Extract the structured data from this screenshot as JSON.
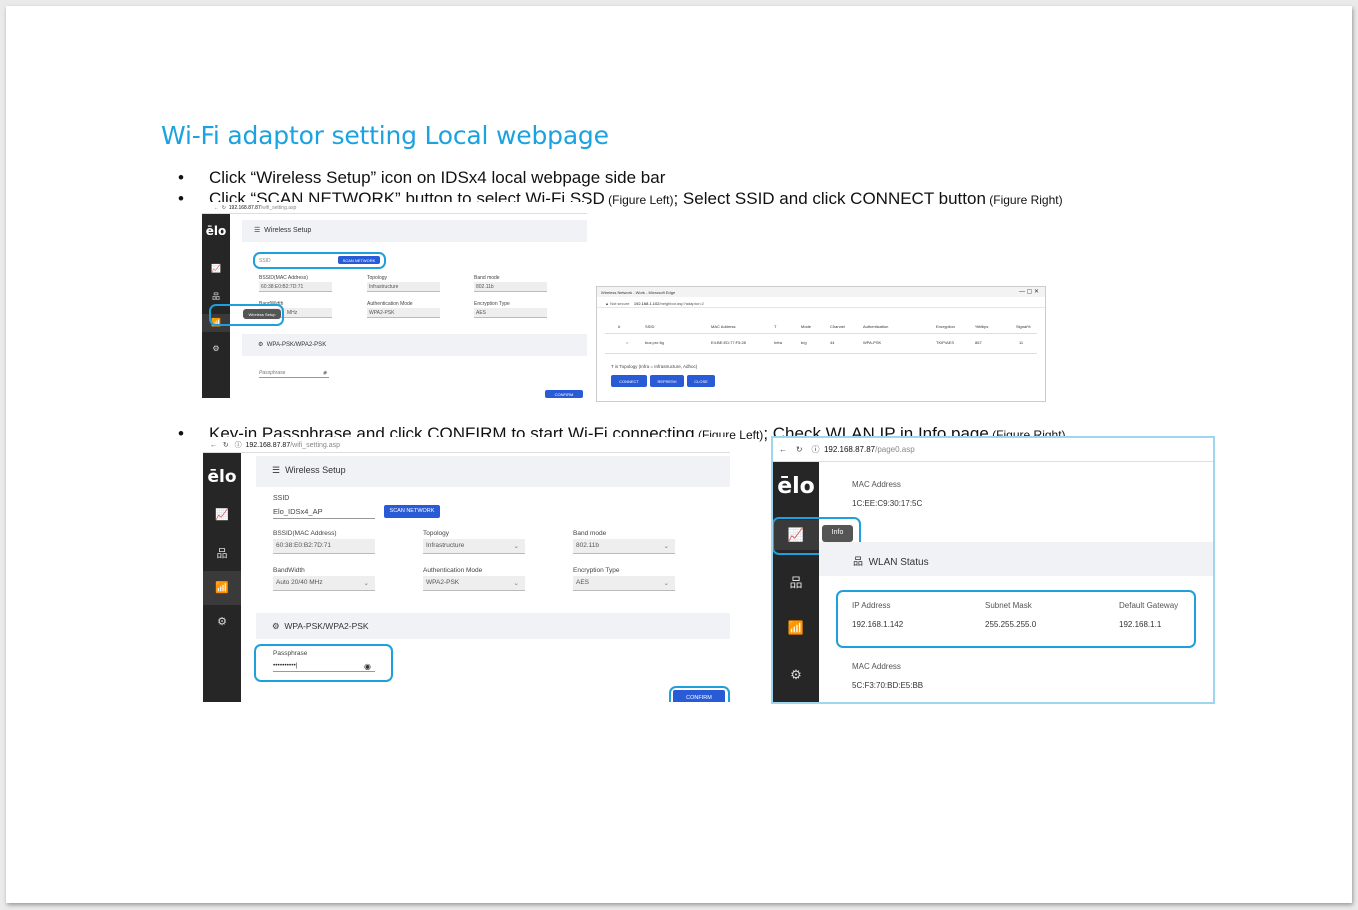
{
  "slide": {
    "title": "Wi-Fi adaptor setting Local webpage",
    "bullet1": "Click “Wireless Setup” icon on IDSx4 local webpage side bar",
    "bullet2_main": "Click “SCAN NETWORK” button to select Wi-Fi SSD",
    "bullet2_note1": " (Figure Left)",
    "bullet2_sep": "; Select SSID and click CONNECT button",
    "bullet2_note2": " (Figure Right)",
    "bullet3_main": "Key-in Passphrase and click CONFIRM to start Wi-Fi connecting",
    "bullet3_note1": " (Figure Left)",
    "bullet3_sep": "; Check WLAN IP in Info page",
    "bullet3_note2": " (Figure Right)",
    "bullet_dot": "•"
  },
  "shot1": {
    "url_host": "192.168.87.87",
    "url_path": "/wifi_setting.asp",
    "logo": "ēlo",
    "header": "Wireless Setup",
    "ssid_placeholder": "SSID",
    "scan_button": "SCAN NETWORK",
    "bssid_label": "BSSID(MAC Address)",
    "bssid_value": "60:38:E0:B2:7D:71",
    "topology_label": "Topology",
    "topology_value": "Infrastructure",
    "band_label": "Band mode",
    "band_value": "802.11b",
    "bandwidth_label": "BandWidth",
    "bandwidth_value": "MHz",
    "auth_label": "Authentication Mode",
    "auth_value": "WPA2-PSK",
    "enc_label": "Encryption Type",
    "enc_value": "AES",
    "tooltip": "Wireless Setup",
    "section": "WPA-PSK/WPA2-PSK",
    "passphrase_placeholder": "Passphrase",
    "confirm_button": "CONFIRM"
  },
  "shot2": {
    "window_title": "Wireless Network - Work - Microsoft Edge",
    "win_controls": "—   ▢   ✕",
    "not_secure": "Not secure",
    "url_host": "192.168.1.102",
    "url_path": "/neighbor.asp?adaptor=2",
    "columns": [
      "#",
      "SSID",
      "MAC Address",
      "T",
      "Mode",
      "Channel",
      "Authentication",
      "Encryption",
      "%Mbps",
      "Signal%"
    ],
    "row": [
      "○",
      "bus pro 6g",
      "E4:BE:ED:77:F5:28",
      "Infra",
      "b/g",
      "44",
      "WPA-PSK",
      "TKIP/AES",
      "867",
      "11"
    ],
    "legend": "T is Topology (Infra = Infrastructure, Adhoc)",
    "connect_button": "CONNECT",
    "refresh_button": "REFRESH",
    "close_button": "CLOSE"
  },
  "shot3": {
    "url_host": "192.168.87.87",
    "url_path": "/wifi_setting.asp",
    "logo": "ēlo",
    "header": "Wireless Setup",
    "ssid_label": "SSID",
    "ssid_value": "Elo_IDSx4_AP",
    "scan_button": "SCAN NETWORK",
    "bssid_label": "BSSID(MAC Address)",
    "bssid_value": "60:38:E0:B2:7D:71",
    "topology_label": "Topology",
    "topology_value": "Infrastructure",
    "band_label": "Band mode",
    "band_value": "802.11b",
    "bandwidth_label": "BandWidth",
    "bandwidth_value": "Auto 20/40 MHz",
    "auth_label": "Authentication Mode",
    "auth_value": "WPA2-PSK",
    "enc_label": "Encryption Type",
    "enc_value": "AES",
    "section": "WPA-PSK/WPA2-PSK",
    "passphrase_label": "Passphrase",
    "passphrase_value": "••••••••••|",
    "confirm_button": "CONFIRM"
  },
  "shot4": {
    "url_host": "192.168.87.87",
    "url_path": "/page0.asp",
    "logo": "ēlo",
    "mac_label": "MAC Address",
    "mac_value": "1C:EE:C9:30:17:5C",
    "tooltip": "Info",
    "section": "WLAN Status",
    "ip_label": "IP Address",
    "ip_value": "192.168.1.142",
    "mask_label": "Subnet Mask",
    "mask_value": "255.255.255.0",
    "gw_label": "Default Gateway",
    "gw_value": "192.168.1.1",
    "mac2_label": "MAC Address",
    "mac2_value": "5C:F3:70:BD:E5:BB"
  },
  "icons": {
    "chart": "📈",
    "network": "品",
    "wifi": "📶",
    "gears": "⚙",
    "menu": "☰",
    "eye": "◉",
    "back": "←",
    "reload": "↻",
    "info": "ⓘ",
    "warning": "▲"
  }
}
